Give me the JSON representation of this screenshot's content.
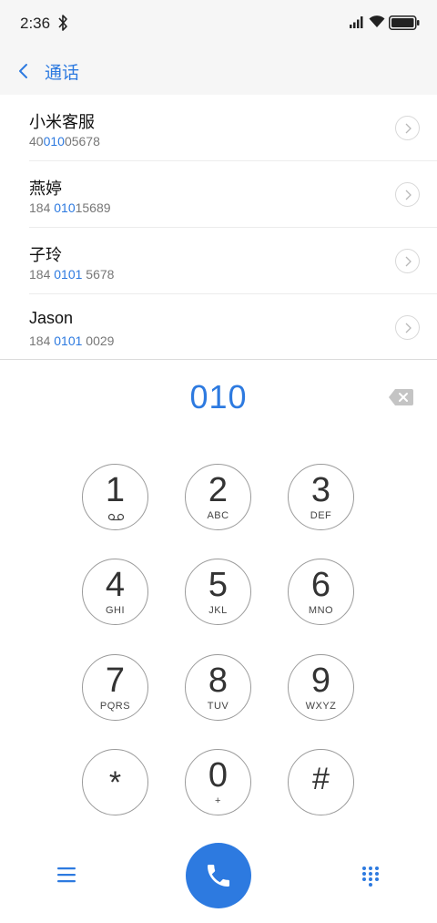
{
  "status_bar": {
    "time": "2:36",
    "icons": [
      "bluetooth-icon",
      "signal-icon",
      "wifi-icon",
      "battery-icon"
    ]
  },
  "header": {
    "title": "通话",
    "back_icon": "chevron-left-icon"
  },
  "contacts": [
    {
      "name": "小米客服",
      "number_pre": "40",
      "number_match": "010",
      "number_post": "05678"
    },
    {
      "name": "燕婷",
      "number_pre": "184 ",
      "number_match": "010",
      "number_post": "15689"
    },
    {
      "name": "子玲",
      "number_pre": "184 ",
      "number_match": "0101",
      "number_post": " 5678"
    },
    {
      "name": "Jason",
      "number_pre": "184 ",
      "number_match": "0101",
      "number_post": " 0029"
    }
  ],
  "dial": {
    "number": "010"
  },
  "keypad": [
    {
      "digit": "1",
      "letters": ""
    },
    {
      "digit": "2",
      "letters": "ABC"
    },
    {
      "digit": "3",
      "letters": "DEF"
    },
    {
      "digit": "4",
      "letters": "GHI"
    },
    {
      "digit": "5",
      "letters": "JKL"
    },
    {
      "digit": "6",
      "letters": "MNO"
    },
    {
      "digit": "7",
      "letters": "PQRS"
    },
    {
      "digit": "8",
      "letters": "TUV"
    },
    {
      "digit": "9",
      "letters": "WXYZ"
    },
    {
      "digit": "*",
      "letters": ""
    },
    {
      "digit": "0",
      "letters": "+"
    },
    {
      "digit": "#",
      "letters": ""
    }
  ],
  "colors": {
    "accent": "#2d7ae0",
    "background": "#ffffff",
    "header_bg": "#f6f6f6",
    "key_border": "#9a9a9a"
  },
  "bottom_bar": {
    "icons": [
      "menu-icon",
      "phone-icon",
      "dialpad-icon"
    ]
  }
}
